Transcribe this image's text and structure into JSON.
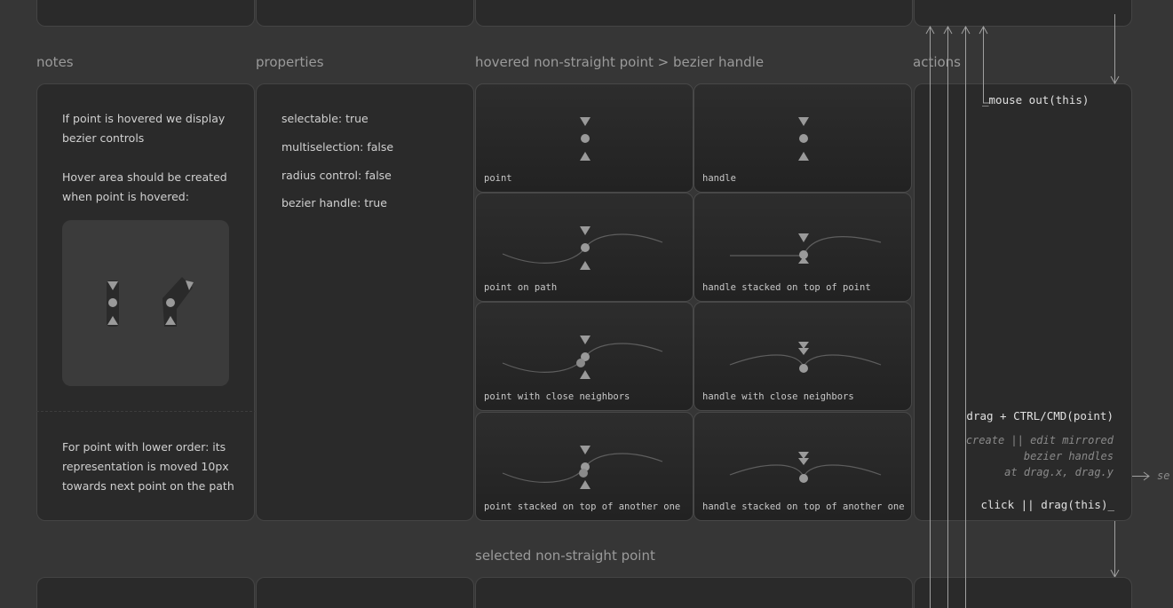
{
  "sections": {
    "notes": "notes",
    "properties": "properties",
    "hovered": "hovered non-straight point > bezier handle",
    "actions": "actions",
    "selected": "selected non-straight point"
  },
  "notes": {
    "paragraph1": "If point is hovered we display\nbezier controls",
    "paragraph2": "Hover area should be created\nwhen point is hovered:",
    "paragraph3": "For point with lower order: its\nrepresentation is moved 10px\ntowards next point on the path"
  },
  "properties": [
    "selectable: true",
    "multiselection: false",
    "radius control: false",
    "bezier handle: true"
  ],
  "tiles": [
    {
      "label": "point"
    },
    {
      "label": "handle"
    },
    {
      "label": "point on path"
    },
    {
      "label": "handle stacked on top of point"
    },
    {
      "label": "point with close neighbors"
    },
    {
      "label": "handle with close neighbors"
    },
    {
      "label": "point stacked on top of another one"
    },
    {
      "label": "handle stacked on top of another one"
    }
  ],
  "actions": {
    "mouse_out": "_mouse out(this)",
    "drag_ctrl": "drag + CTRL/CMD(point)",
    "drag_ctrl_desc": "create || edit mirrored\nbezier handles\nat drag.x, drag.y",
    "click_drag": "click || drag(this)_",
    "arrow_target": "se"
  },
  "colors": {
    "background": "#363636",
    "card": "#2a2a2a",
    "point": "#9a9a9a",
    "curve": "#5e5e5e"
  }
}
